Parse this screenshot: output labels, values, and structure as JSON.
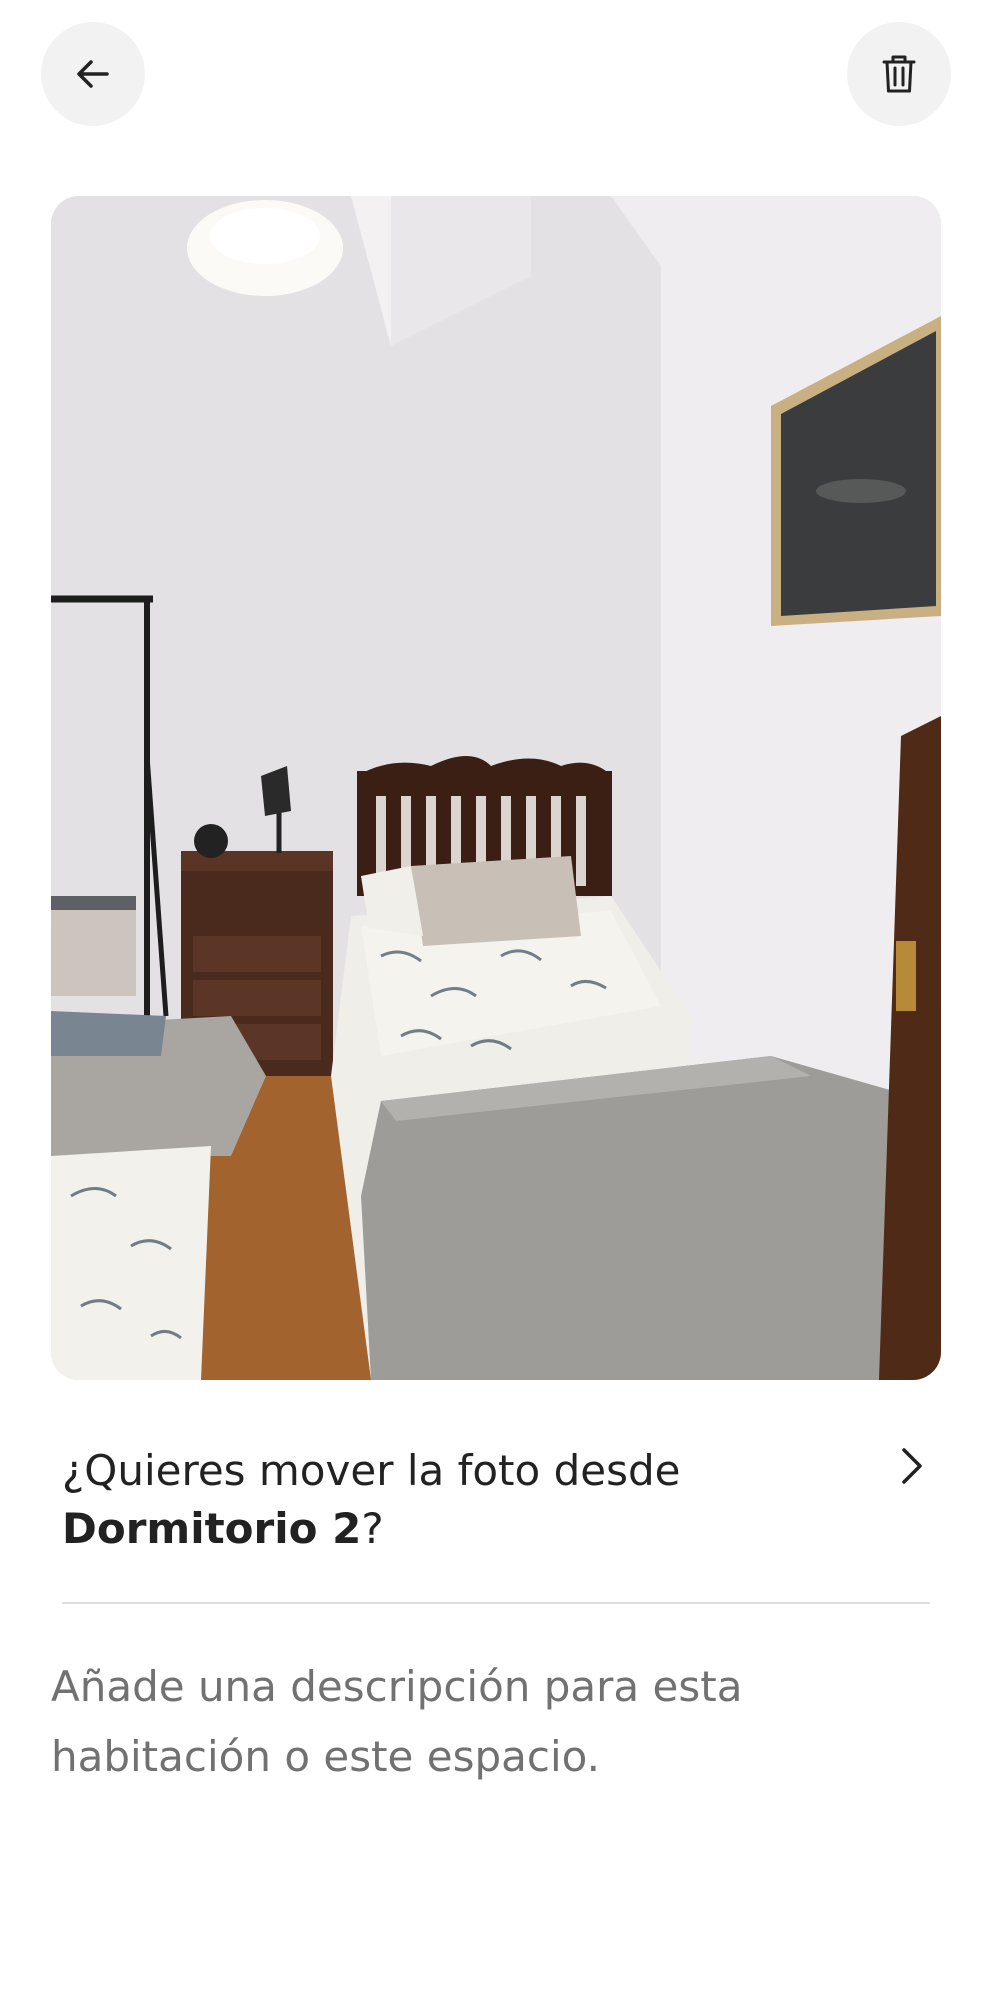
{
  "header": {
    "back_icon": "arrow-left-icon",
    "delete_icon": "trash-icon"
  },
  "photo": {
    "description": "Bedroom photo with two single beds, wooden headboard, nightstand with lamp and framed picture"
  },
  "move_prompt": {
    "prefix": "¿Quieres mover la foto desde ",
    "room": "Dormitorio 2",
    "suffix": "?",
    "chevron_icon": "chevron-right-icon"
  },
  "description_field": {
    "placeholder": "Añade una descripción para esta habitación o este espacio."
  },
  "colors": {
    "button_bg": "#f2f2f2",
    "text_primary": "#222222",
    "text_secondary": "#717171",
    "divider": "#dddddd"
  }
}
